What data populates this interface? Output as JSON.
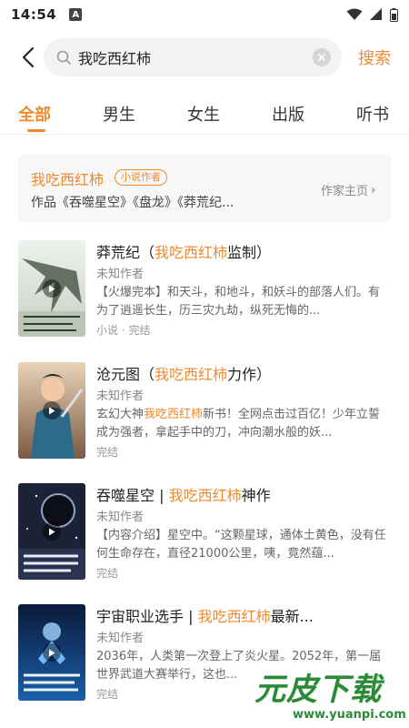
{
  "status": {
    "time": "14:54",
    "notif_letter": "A"
  },
  "search": {
    "query": "我吃西红柿",
    "button": "搜索"
  },
  "tabs": [
    {
      "label": "全部"
    },
    {
      "label": "男生"
    },
    {
      "label": "女生"
    },
    {
      "label": "出版"
    },
    {
      "label": "听书"
    }
  ],
  "author": {
    "name": "我吃西红柿",
    "tag": "小说作者",
    "works": "作品《吞噬星空》《盘龙》《莽荒纪...",
    "home": "作家主页"
  },
  "books": [
    {
      "title_pre": "莽荒纪（",
      "title_hl": "我吃西红柿",
      "title_post": "监制）",
      "author": "未知作者",
      "desc": "【火爆完本】和天斗，和地斗，和妖斗的部落人们。有为了逍遥长生，历三灾九劫，纵死无悔的...",
      "meta": "小说 · 完结"
    },
    {
      "title_pre": "沧元图（",
      "title_hl": "我吃西红柿",
      "title_post": "力作）",
      "author": "未知作者",
      "desc_pre": "玄幻大神",
      "desc_hl": "我吃西红柿",
      "desc_post": "新书！全网点击过百亿！少年立誓成为强者，拿起手中的刀，冲向潮水般的妖...",
      "meta": "完结"
    },
    {
      "title_pre": "吞噬星空 | ",
      "title_hl": "我吃西红柿",
      "title_post": "神作",
      "author": "未知作者",
      "desc": "【内容介绍】星空中。“这颗星球，通体土黄色，没有任何生命存在，直径21000公里，咦，竟然蕴...",
      "meta": "完结"
    },
    {
      "title_pre": "宇宙职业选手 | ",
      "title_hl": "我吃西红柿",
      "title_post": "最新...",
      "author": "未知作者",
      "desc": "2036年，人类第一次登上了炎火星。2052年，第一届世界武道大赛举行，这也...",
      "meta": "完结"
    }
  ],
  "watermark": {
    "text": "元皮下载",
    "url": "www.yuanpi.com"
  }
}
